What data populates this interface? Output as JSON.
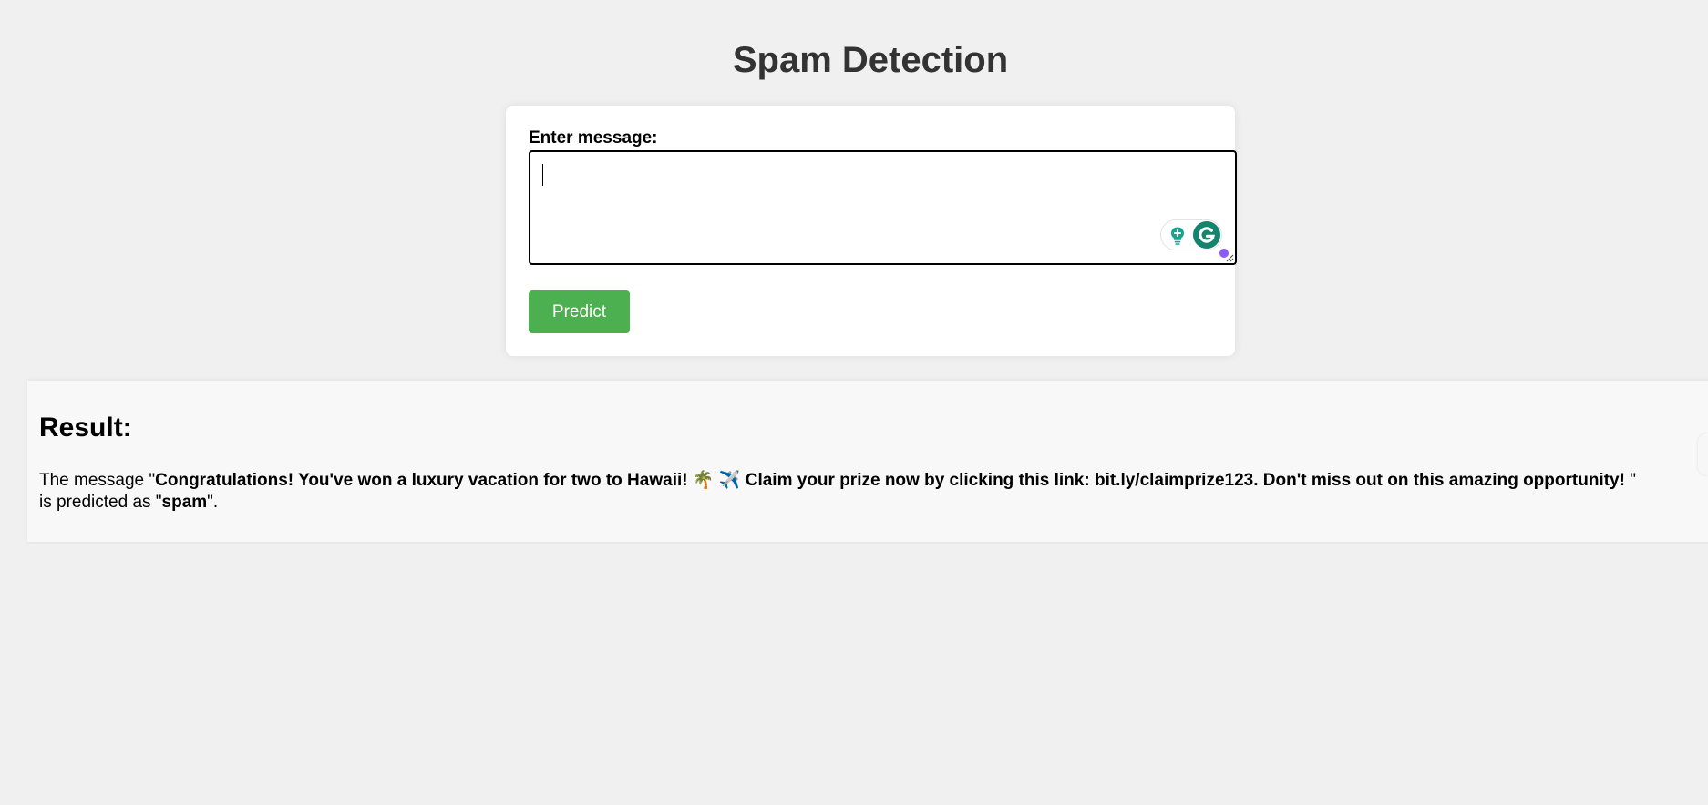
{
  "page": {
    "title": "Spam Detection"
  },
  "form": {
    "label": "Enter message:",
    "message_value": "",
    "predict_label": "Predict"
  },
  "icons": {
    "grammarly_suggestions": "lightbulb-plus-icon",
    "grammarly_logo": "grammarly-g-icon",
    "status_indicator": "status-dot-icon",
    "resize_handle": "resize-grip-icon"
  },
  "result": {
    "heading": "Result:",
    "prefix": "The message \"",
    "message": "Congratulations! You've won a luxury vacation for two to Hawaii! 🌴 ✈️ Claim your prize now by clicking this link: bit.ly/claimprize123. Don't miss out on this amazing opportunity! ",
    "middle": "\" is predicted as \"",
    "prediction": "spam",
    "suffix": "\"."
  },
  "colors": {
    "background": "#f0f0f0",
    "title": "#333333",
    "button": "#4caf50",
    "grammarly": "#15846f",
    "status_dot": "#8a5cf5"
  }
}
